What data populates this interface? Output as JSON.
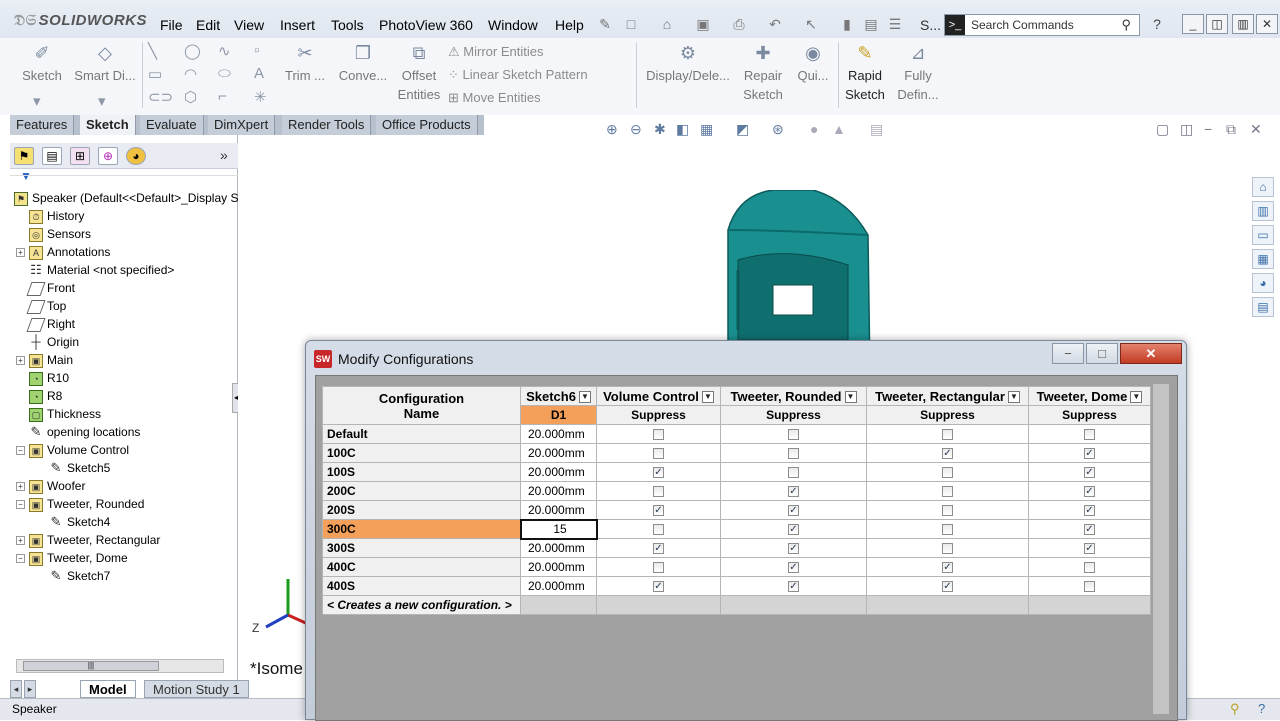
{
  "app": {
    "logo": "SOLIDWORKS"
  },
  "menu": [
    "File",
    "Edit",
    "View",
    "Insert",
    "Tools",
    "PhotoView 360",
    "Window",
    "Help"
  ],
  "search": {
    "placeholder": "Search Commands",
    "truncated_label": "S..."
  },
  "commands": {
    "sketch": "Sketch",
    "smart_dim": "Smart Di...",
    "trim": "Trim ...",
    "convert": "Conve...",
    "offset_1": "Offset",
    "offset_2": "Entities",
    "mirror": "Mirror Entities",
    "linear_pattern": "Linear Sketch Pattern",
    "move": "Move Entities",
    "display_delete": "Display/Dele...",
    "repair_1": "Repair",
    "repair_2": "Sketch",
    "quick": "Qui...",
    "rapid_1": "Rapid",
    "rapid_2": "Sketch",
    "fully_1": "Fully",
    "fully_2": "Defin..."
  },
  "tabs": [
    "Features",
    "Sketch",
    "Evaluate",
    "DimXpert",
    "Render Tools",
    "Office Products"
  ],
  "active_tab": "Sketch",
  "tree": {
    "root": "Speaker  (Default<<Default>_Display S",
    "items": [
      {
        "label": "History",
        "indent": 1,
        "expand": false,
        "icon": "history-icon"
      },
      {
        "label": "Sensors",
        "indent": 1,
        "expand": false,
        "icon": "sensors-icon"
      },
      {
        "label": "Annotations",
        "indent": 1,
        "expand": true,
        "icon": "annotations-icon"
      },
      {
        "label": "Material <not specified>",
        "indent": 1,
        "expand": false,
        "icon": "material-icon"
      },
      {
        "label": "Front",
        "indent": 1,
        "expand": false,
        "icon": "plane-icon"
      },
      {
        "label": "Top",
        "indent": 1,
        "expand": false,
        "icon": "plane-icon"
      },
      {
        "label": "Right",
        "indent": 1,
        "expand": false,
        "icon": "plane-icon"
      },
      {
        "label": "Origin",
        "indent": 1,
        "expand": false,
        "icon": "origin-icon"
      },
      {
        "label": "Main",
        "indent": 1,
        "expand": true,
        "icon": "extrude-icon"
      },
      {
        "label": "R10",
        "indent": 1,
        "expand": false,
        "icon": "fillet-icon"
      },
      {
        "label": "R8",
        "indent": 1,
        "expand": false,
        "icon": "fillet-icon"
      },
      {
        "label": "Thickness",
        "indent": 1,
        "expand": false,
        "icon": "shell-icon"
      },
      {
        "label": "opening locations",
        "indent": 1,
        "expand": false,
        "icon": "sketch-icon"
      },
      {
        "label": "Volume Control",
        "indent": 1,
        "expand": "open",
        "icon": "cut-icon"
      },
      {
        "label": "Sketch5",
        "indent": 2,
        "expand": false,
        "icon": "sketch-icon"
      },
      {
        "label": "Woofer",
        "indent": 1,
        "expand": true,
        "icon": "cut-icon"
      },
      {
        "label": "Tweeter, Rounded",
        "indent": 1,
        "expand": "open",
        "icon": "cut-icon"
      },
      {
        "label": "Sketch4",
        "indent": 2,
        "expand": false,
        "icon": "sketch-icon"
      },
      {
        "label": "Tweeter, Rectangular",
        "indent": 1,
        "expand": true,
        "icon": "cut-icon"
      },
      {
        "label": "Tweeter, Dome",
        "indent": 1,
        "expand": "open",
        "icon": "cut-icon"
      },
      {
        "label": "Sketch7",
        "indent": 2,
        "expand": false,
        "icon": "sketch-icon"
      }
    ]
  },
  "graphics": {
    "view_label": "*Isome",
    "axis_z": "Z"
  },
  "bottom_tabs": [
    "Model",
    "Motion Study 1"
  ],
  "status": "Speaker",
  "dialog": {
    "title": "Modify Configurations",
    "config_header_1": "Configuration",
    "config_header_2": "Name",
    "columns": [
      {
        "header": "Sketch6",
        "sub": "D1"
      },
      {
        "header": "Volume Control",
        "sub": "Suppress"
      },
      {
        "header": "Tweeter, Rounded",
        "sub": "Suppress"
      },
      {
        "header": "Tweeter, Rectangular",
        "sub": "Suppress"
      },
      {
        "header": "Tweeter, Dome",
        "sub": "Suppress"
      }
    ],
    "rows": [
      {
        "name": "Default",
        "d1": "20.000mm",
        "checks": [
          false,
          false,
          false,
          false
        ]
      },
      {
        "name": "100C",
        "d1": "20.000mm",
        "checks": [
          false,
          false,
          true,
          true
        ]
      },
      {
        "name": "100S",
        "d1": "20.000mm",
        "checks": [
          true,
          false,
          false,
          true
        ]
      },
      {
        "name": "200C",
        "d1": "20.000mm",
        "checks": [
          false,
          true,
          false,
          true
        ]
      },
      {
        "name": "200S",
        "d1": "20.000mm",
        "checks": [
          true,
          true,
          false,
          true
        ]
      },
      {
        "name": "300C",
        "d1": "15",
        "checks": [
          false,
          true,
          false,
          true
        ],
        "selected": true,
        "editing": true
      },
      {
        "name": "300S",
        "d1": "20.000mm",
        "checks": [
          true,
          true,
          false,
          true
        ]
      },
      {
        "name": "400C",
        "d1": "20.000mm",
        "checks": [
          false,
          true,
          true,
          false
        ]
      },
      {
        "name": "400S",
        "d1": "20.000mm",
        "checks": [
          true,
          true,
          true,
          false
        ]
      }
    ],
    "new_row": "< Creates a new configuration. >"
  }
}
